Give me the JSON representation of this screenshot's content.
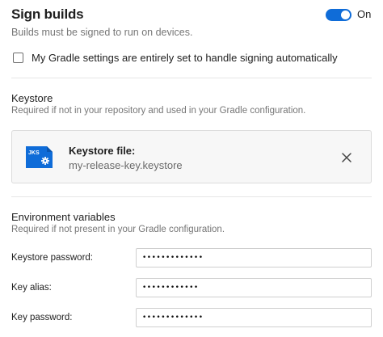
{
  "header": {
    "title": "Sign builds",
    "subtitle": "Builds must be signed to run on devices.",
    "toggle_label": "On",
    "toggle_on": true
  },
  "gradle_checkbox": {
    "label": "My Gradle settings are entirely set to handle signing automatically",
    "checked": false
  },
  "keystore": {
    "title": "Keystore",
    "description": "Required if not in your repository and used in your Gradle configuration.",
    "icon_text": "JKS",
    "file_label": "Keystore file:",
    "file_name": "my-release-key.keystore"
  },
  "env": {
    "title": "Environment variables",
    "description": "Required if not present in your Gradle configuration.",
    "fields": [
      {
        "label": "Keystore password:",
        "value": "•••••••••••••"
      },
      {
        "label": "Key alias:",
        "value": "••••••••••••"
      },
      {
        "label": "Key password:",
        "value": "•••••••••••••"
      }
    ]
  },
  "colors": {
    "accent": "#0f6cd8",
    "muted_text": "#767676",
    "card_bg": "#f7f7f7"
  },
  "icons": {
    "toggle": "toggle-switch",
    "file": "jks-file-icon",
    "close": "close-icon"
  }
}
